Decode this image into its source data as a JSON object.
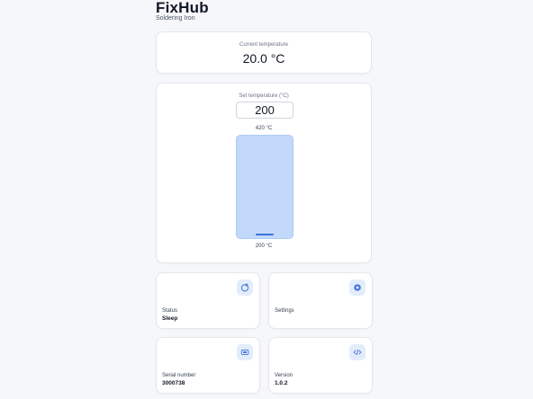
{
  "app": {
    "title": "FixHub",
    "subtitle": "Soldering Iron"
  },
  "current": {
    "label": "Current temperature",
    "value": "20.0 °C"
  },
  "setpoint": {
    "label": "Set temperature (°C)",
    "value": "200",
    "max_label": "420 °C",
    "min_label": "200 °C",
    "fill_fraction": 0.0
  },
  "tiles": {
    "status": {
      "label": "Status",
      "value": "Sleep",
      "icon": "sleep-icon"
    },
    "settings": {
      "label": "Settings",
      "icon": "gear-icon"
    },
    "serial": {
      "label": "Serial number",
      "value": "3000738",
      "icon": "chip-icon"
    },
    "version": {
      "label": "Version",
      "value": "1.0.2",
      "icon": "code-icon"
    }
  },
  "colors": {
    "accent": "#3b73d9",
    "accent_light": "#c3d9fb",
    "icon_bg": "#e3ecfb"
  }
}
